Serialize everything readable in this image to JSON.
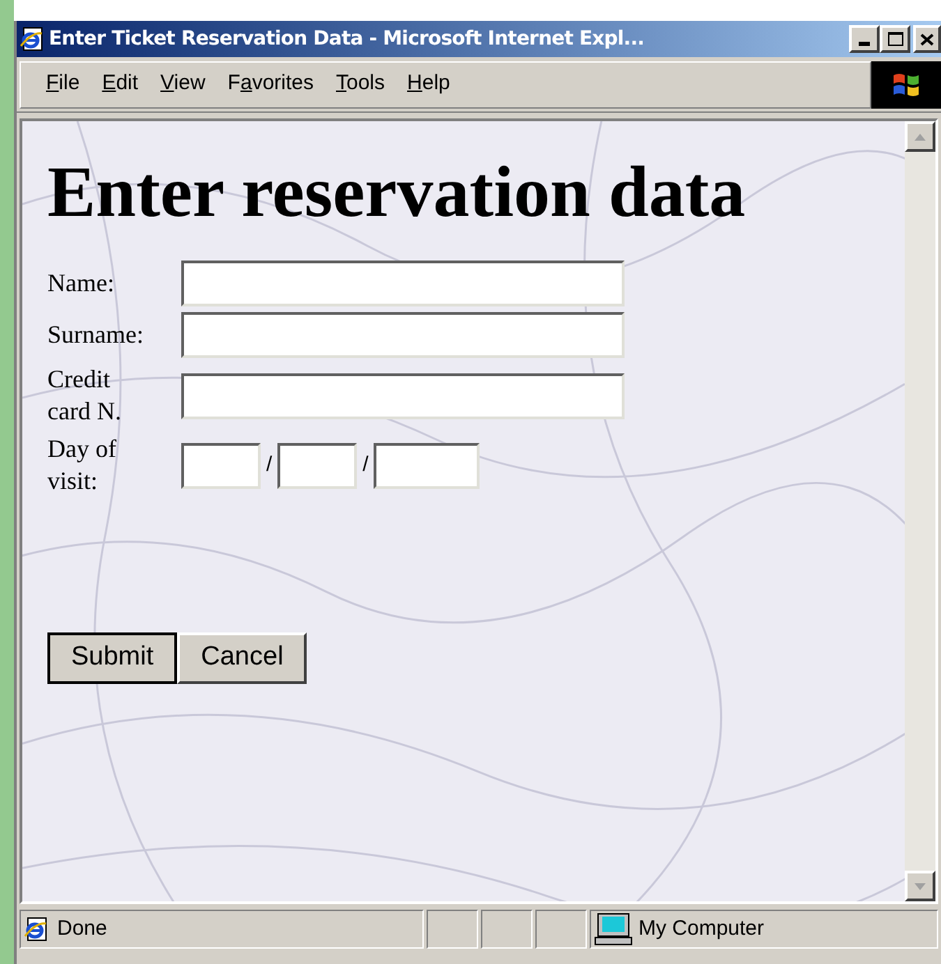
{
  "window": {
    "title": "Enter Ticket Reservation Data - Microsoft Internet Expl..."
  },
  "menu": [
    {
      "key": "F",
      "after": "ile"
    },
    {
      "key": "E",
      "after": "dit"
    },
    {
      "key": "V",
      "after": "iew"
    },
    {
      "before": "F",
      "key": "a",
      "after": "vorites"
    },
    {
      "key": "T",
      "after": "ools"
    },
    {
      "key": "H",
      "after": "elp"
    }
  ],
  "page": {
    "heading": "Enter reservation data",
    "fields": [
      {
        "kind": "text",
        "label": "Name:"
      },
      {
        "kind": "text",
        "label": "Surname:"
      },
      {
        "kind": "text",
        "label": "Credit card N."
      },
      {
        "kind": "date",
        "label": "Day of visit:",
        "separators": [
          "/",
          "/"
        ]
      }
    ],
    "buttons": [
      "Submit",
      "Cancel"
    ]
  },
  "status_bar": {
    "text": "Done",
    "zone": "My Computer"
  }
}
